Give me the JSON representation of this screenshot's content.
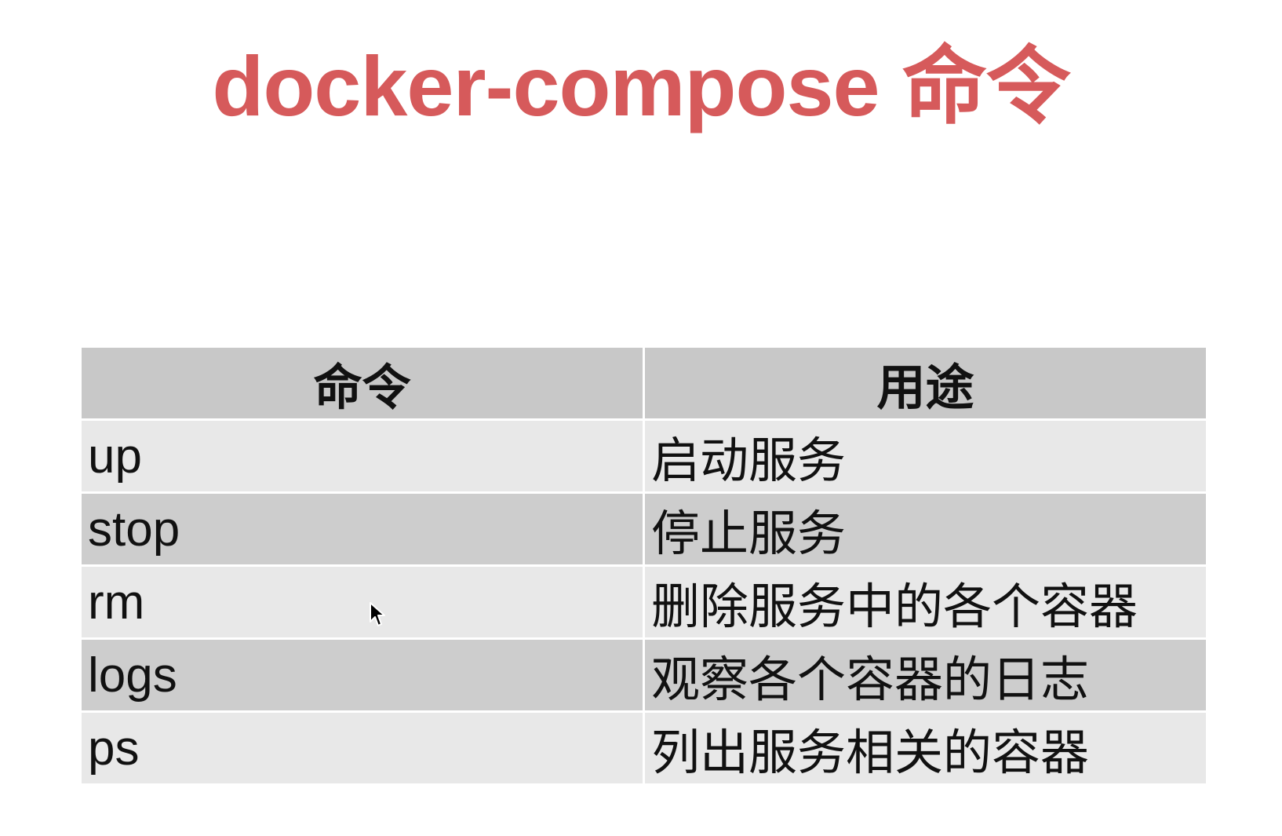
{
  "slide": {
    "title": "docker-compose 命令",
    "title_color": "#d65a5b"
  },
  "table": {
    "headers": [
      "命令",
      "用途"
    ],
    "rows": [
      {
        "command": "up",
        "purpose": "启动服务"
      },
      {
        "command": "stop",
        "purpose": "停止服务"
      },
      {
        "command": "rm",
        "purpose": "删除服务中的各个容器"
      },
      {
        "command": "logs",
        "purpose": "观察各个容器的日志"
      },
      {
        "command": "ps",
        "purpose": "列出服务相关的容器"
      }
    ],
    "header_bg": "#c8c8c8",
    "row_bg_light": "#e8e8e8",
    "row_bg_dark": "#cdcdcd"
  },
  "cursor": {
    "icon": "mouse-pointer-icon"
  }
}
